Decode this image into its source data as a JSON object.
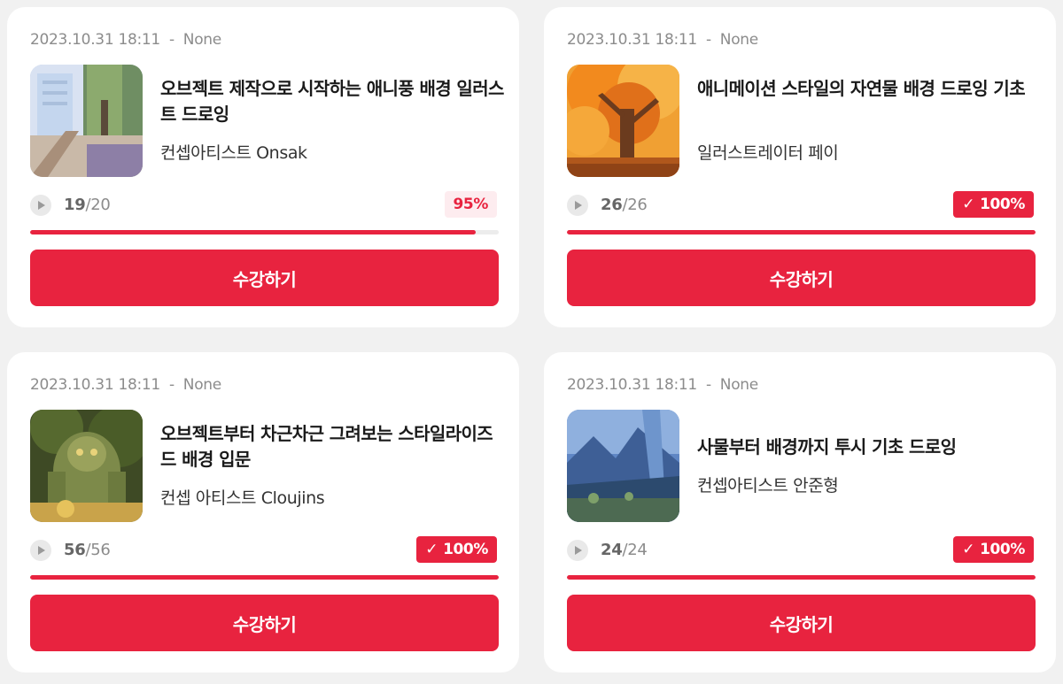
{
  "accent": "#e8233f",
  "courses": [
    {
      "date": "2023.10.31 18:11",
      "separator": "-",
      "status": "None",
      "title": "오브젝트 제작으로 시작하는 애니풍 배경 일러스트 드로잉",
      "author": "컨셉아티스트 Onsak",
      "done": "19",
      "total": "/20",
      "progress_label": "95%",
      "progress": 0.95,
      "completed": false,
      "button": "수강하기",
      "thumbnail_icon": "anime-street-thumbnail"
    },
    {
      "date": "2023.10.31 18:11",
      "separator": "-",
      "status": "None",
      "title": "애니메이션 스타일의 자연물 배경 드로잉 기초",
      "author": "일러스트레이터 페이",
      "done": "26",
      "total": "/26",
      "progress_label": "100%",
      "progress": 1.0,
      "completed": true,
      "check_icon": "✓",
      "button": "수강하기",
      "thumbnail_icon": "autumn-tree-thumbnail"
    },
    {
      "date": "2023.10.31 18:11",
      "separator": "-",
      "status": "None",
      "title": "오브젝트부터 차근차근 그려보는 스타일라이즈드 배경 입문",
      "author": "컨셉 아티스트 Cloujins",
      "done": "56",
      "total": "/56",
      "progress_label": "100%",
      "progress": 1.0,
      "completed": true,
      "check_icon": "✓",
      "button": "수강하기",
      "thumbnail_icon": "stone-golem-thumbnail"
    },
    {
      "date": "2023.10.31 18:11",
      "separator": "-",
      "status": "None",
      "title": "사물부터 배경까지 투시 기초 드로잉",
      "author": "컨셉아티스트 안준형",
      "done": "24",
      "total": "/24",
      "progress_label": "100%",
      "progress": 1.0,
      "completed": true,
      "check_icon": "✓",
      "button": "수강하기",
      "thumbnail_icon": "blue-mountain-thumbnail"
    }
  ]
}
